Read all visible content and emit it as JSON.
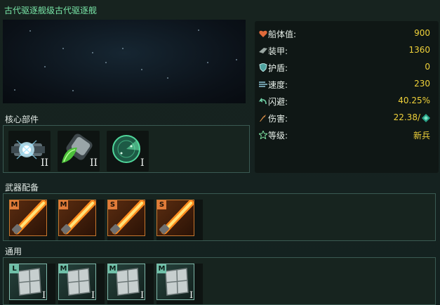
{
  "title": "古代驱逐舰级古代驱逐舰",
  "stats": [
    {
      "icon": "heart-icon",
      "label": "船体值:",
      "value": "900"
    },
    {
      "icon": "armor-icon",
      "label": "装甲:",
      "value": "1360"
    },
    {
      "icon": "shield-icon",
      "label": "护盾:",
      "value": "0"
    },
    {
      "icon": "speed-icon",
      "label": "速度:",
      "value": "230"
    },
    {
      "icon": "evade-icon",
      "label": "闪避:",
      "value": "40.25%"
    },
    {
      "icon": "damage-icon",
      "label": "伤害:",
      "value": "22.38/"
    },
    {
      "icon": "star-icon",
      "label": "等级:",
      "value": "新兵"
    }
  ],
  "sections": {
    "core": {
      "title": "核心部件",
      "slots": [
        {
          "icon": "energy-core-icon",
          "tier": "II"
        },
        {
          "icon": "plasma-emitter-icon",
          "tier": "II"
        },
        {
          "icon": "radar-icon",
          "tier": "I"
        }
      ]
    },
    "weapons": {
      "title": "武器配备",
      "slots": [
        {
          "icon": "laser-cannon-icon",
          "size": "M"
        },
        {
          "icon": "laser-cannon-icon",
          "size": "M"
        },
        {
          "icon": "laser-cannon-icon",
          "size": "S"
        },
        {
          "icon": "laser-cannon-icon",
          "size": "S"
        }
      ]
    },
    "general": {
      "title": "通用",
      "slots": [
        {
          "icon": "armor-plate-icon",
          "size": "L",
          "tier": "I"
        },
        {
          "icon": "armor-plate-icon",
          "size": "M",
          "tier": "I"
        },
        {
          "icon": "armor-plate-icon",
          "size": "M",
          "tier": "I"
        },
        {
          "icon": "armor-plate-icon",
          "size": "M",
          "tier": "I"
        }
      ]
    }
  },
  "colors": {
    "title": "#79e7a8",
    "value": "#f0d23a",
    "weapon_frame": "#c8772e",
    "general_frame": "#7fb8aa"
  }
}
